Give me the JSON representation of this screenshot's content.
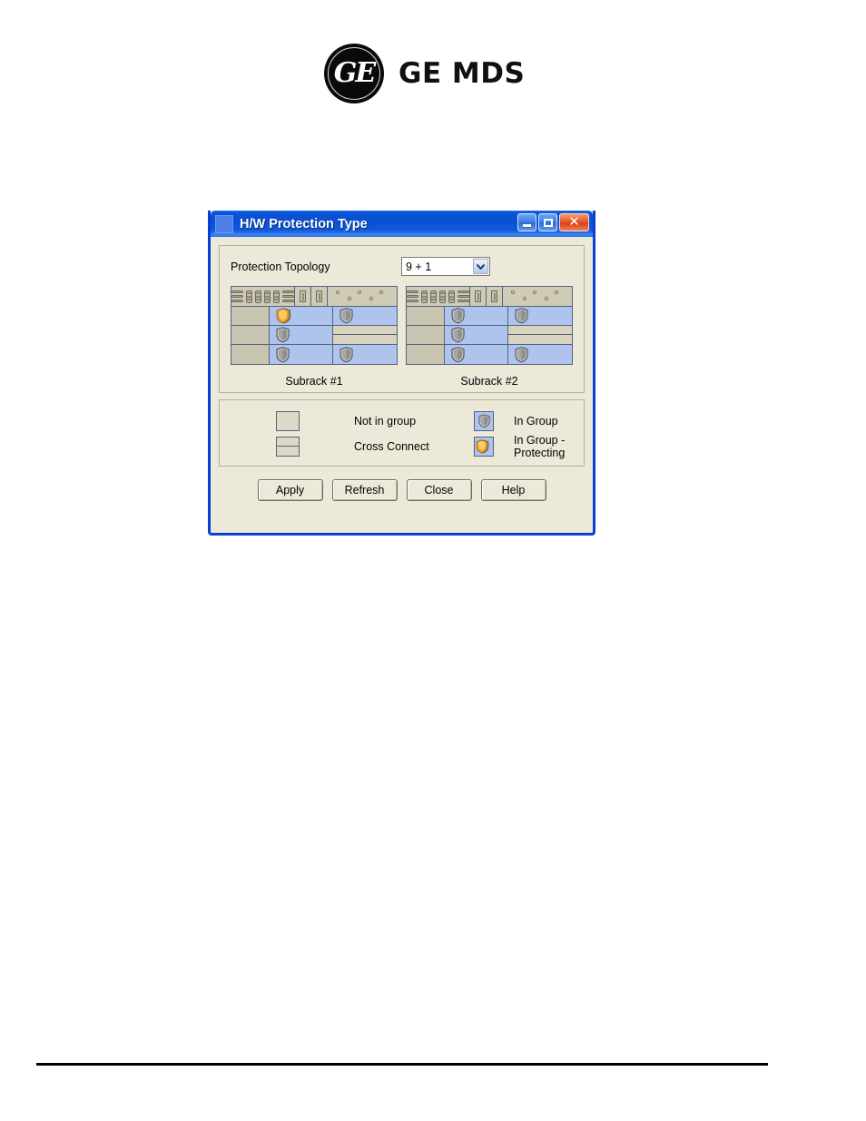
{
  "page": {
    "brand": {
      "monogram_text": "GE",
      "wordmark": "GE MDS"
    }
  },
  "dialog": {
    "title": "H/W Protection Type",
    "window_buttons": {
      "minimize": "minimize-button",
      "maximize": "maximize-button",
      "close": "✕"
    },
    "topology": {
      "label": "Protection Topology",
      "selected": "9 + 1",
      "options": [
        "9 + 1"
      ]
    },
    "subracks": [
      {
        "caption": "Subrack #1",
        "rows": [
          [
            {
              "state": "not_in_group",
              "icon": null
            },
            {
              "state": "in_group",
              "icon": "shield-protecting-icon"
            },
            {
              "state": "in_group",
              "icon": "shield-icon"
            }
          ],
          [
            {
              "state": "not_in_group",
              "icon": null
            },
            {
              "state": "in_group",
              "icon": "shield-icon"
            },
            {
              "state": "cross_connect",
              "icon": null
            }
          ],
          [
            {
              "state": "not_in_group",
              "icon": null
            },
            {
              "state": "in_group",
              "icon": "shield-icon"
            },
            {
              "state": "in_group",
              "icon": "shield-icon"
            }
          ]
        ]
      },
      {
        "caption": "Subrack #2",
        "rows": [
          [
            {
              "state": "not_in_group",
              "icon": null
            },
            {
              "state": "in_group",
              "icon": "shield-icon"
            },
            {
              "state": "in_group",
              "icon": "shield-icon"
            }
          ],
          [
            {
              "state": "not_in_group",
              "icon": null
            },
            {
              "state": "in_group",
              "icon": "shield-icon"
            },
            {
              "state": "cross_connect",
              "icon": null
            }
          ],
          [
            {
              "state": "not_in_group",
              "icon": null
            },
            {
              "state": "in_group",
              "icon": "shield-icon"
            },
            {
              "state": "in_group",
              "icon": "shield-icon"
            }
          ]
        ]
      }
    ],
    "legend": [
      {
        "key": "not-in-group",
        "label": "Not in group",
        "swatch": "plain-box"
      },
      {
        "key": "in-group",
        "label": "In Group",
        "swatch": "shield-icon"
      },
      {
        "key": "cross-connect",
        "label": "Cross Connect",
        "swatch": "split-box"
      },
      {
        "key": "in-group-protecting",
        "label": "In Group - Protecting",
        "swatch": "shield-protecting-icon"
      }
    ],
    "buttons": [
      {
        "key": "apply",
        "label": "Apply"
      },
      {
        "key": "refresh",
        "label": "Refresh"
      },
      {
        "key": "close",
        "label": "Close"
      },
      {
        "key": "help",
        "label": "Help"
      }
    ]
  },
  "colors": {
    "titlebar_blue": "#0a4fd2",
    "dialog_face": "#ece9d8",
    "in_group_blue": "#aec4ed",
    "not_in_group_tan": "#c9c5b0",
    "shield_gray": "#a9a9a9",
    "shield_orange": "#f5a623",
    "close_red": "#d8401a"
  }
}
